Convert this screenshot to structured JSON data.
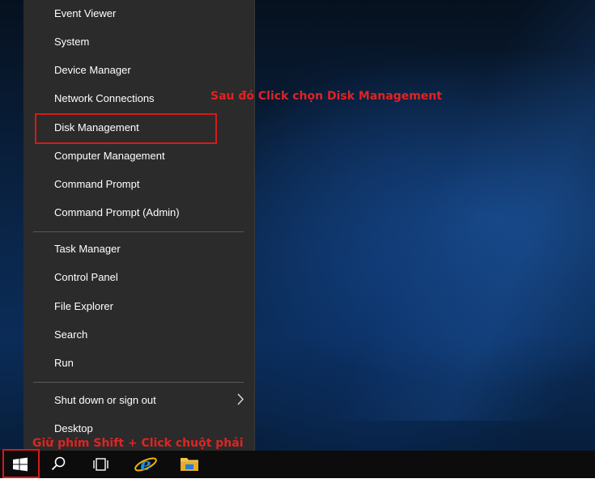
{
  "menu": {
    "items_group1": [
      {
        "label": "Event Viewer"
      },
      {
        "label": "System"
      },
      {
        "label": "Device Manager"
      },
      {
        "label": "Network Connections"
      },
      {
        "label": "Disk Management"
      },
      {
        "label": "Computer Management"
      },
      {
        "label": "Command Prompt"
      },
      {
        "label": "Command Prompt (Admin)"
      }
    ],
    "items_group2": [
      {
        "label": "Task Manager"
      },
      {
        "label": "Control Panel"
      },
      {
        "label": "File Explorer"
      },
      {
        "label": "Search"
      },
      {
        "label": "Run"
      }
    ],
    "items_group3": [
      {
        "label": "Shut down or sign out",
        "submenu_icon": "chevron-right-icon"
      },
      {
        "label": "Desktop"
      }
    ]
  },
  "annotations": {
    "step2": "Sau đó Click chọn Disk Management",
    "step1": "Giữ phím Shift + Click chuột phải",
    "highlight_color": "#d9191a"
  },
  "taskbar": {
    "icons": [
      "windows-start-icon",
      "search-icon",
      "task-view-icon",
      "internet-explorer-icon",
      "file-explorer-icon"
    ]
  },
  "colors": {
    "menu_bg": "#2b2b2b",
    "taskbar_bg": "#0c0c0c",
    "desktop_bg": "#0b2c58"
  }
}
